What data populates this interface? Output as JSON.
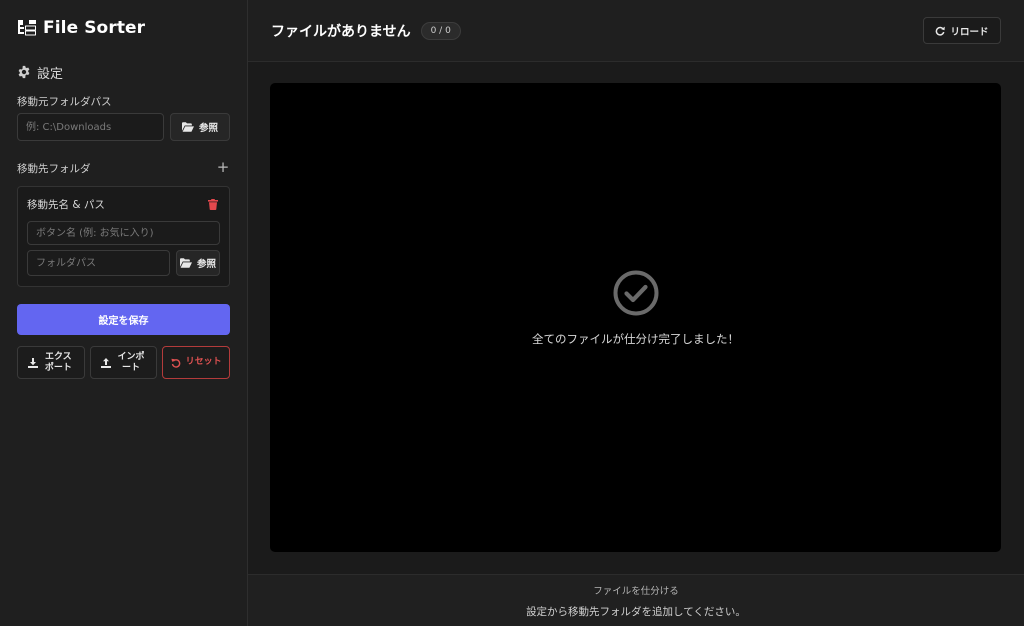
{
  "app": {
    "title": "File Sorter"
  },
  "sidebar": {
    "settings_heading": "設定",
    "source": {
      "label": "移動元フォルダパス",
      "placeholder": "例: C:\\Downloads",
      "browse_label": "参照"
    },
    "destinations": {
      "label": "移動先フォルダ",
      "add_label": "+",
      "card": {
        "title": "移動先名 & パス",
        "name_placeholder": "ボタン名 (例: お気に入り)",
        "path_placeholder": "フォルダパス",
        "browse_label": "参照"
      }
    },
    "save_label": "設定を保存",
    "export_label": "エクスポート",
    "import_label": "インポート",
    "reset_label": "リセット"
  },
  "header": {
    "file_title": "ファイルがありません",
    "counter": "0 / 0",
    "reload_label": "リロード"
  },
  "viewer": {
    "status_icon": "check-circle-icon",
    "message": "全てのファイルが仕分け完了しました！"
  },
  "footer": {
    "title": "ファイルを仕分ける",
    "message": "設定から移動先フォルダを追加してください。"
  },
  "colors": {
    "accent": "#6366f1",
    "danger": "#e05252",
    "background": "#1b1b1b",
    "viewer_bg": "#000000"
  }
}
